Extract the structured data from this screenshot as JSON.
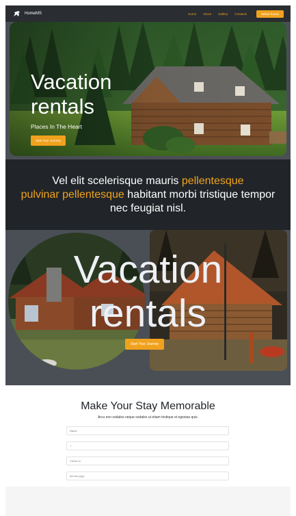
{
  "nav": {
    "brand": "HomeMS",
    "links": [
      "Home",
      "About",
      "Gallery",
      "Contacts"
    ],
    "cta": "Select house"
  },
  "hero": {
    "title_line1": "Vacation",
    "title_line2": "rentals",
    "subtitle": "Places In The Heart",
    "button": "Start Your Journey"
  },
  "quote": {
    "part1": "Vel elit scelerisque mauris ",
    "highlight1": "pellentesque",
    "highlight2": "pulvinar pellentesque",
    "part2": " habitant morbi tristique tempor nec feugiat nisl."
  },
  "hero2": {
    "title_line1": "Vacation",
    "title_line2": "rentals",
    "button": "Start Your Journey"
  },
  "form": {
    "title": "Make Your Stay Memorable",
    "subtitle": "Arcu non sodales neque sodales ut etiam tristique et egestas quis.",
    "fields": [
      {
        "placeholder": "Name"
      },
      {
        "placeholder": "+"
      },
      {
        "placeholder": "Check In"
      },
      {
        "placeholder": "dd.mm.yyyy"
      }
    ]
  },
  "colors": {
    "accent": "#f0a21e",
    "dark": "#212529",
    "slate": "#4a4f56"
  }
}
